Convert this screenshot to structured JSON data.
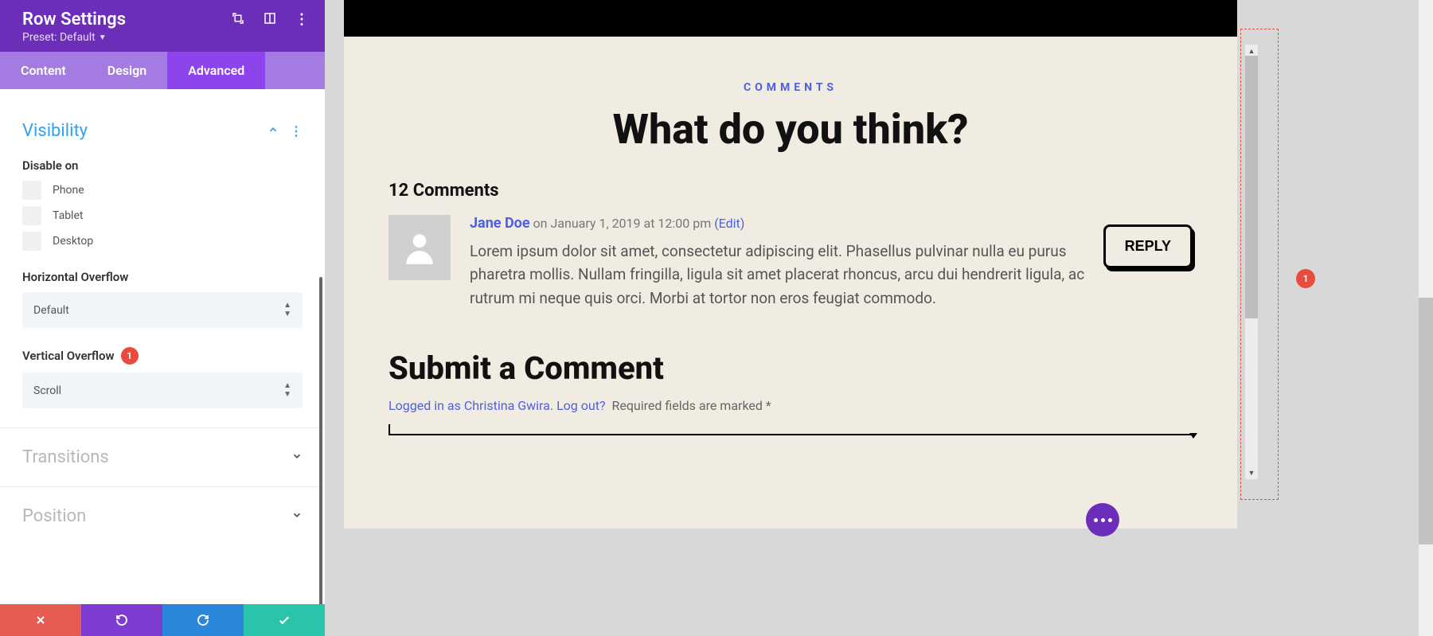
{
  "panel": {
    "title": "Row Settings",
    "preset_label": "Preset: Default",
    "tabs": {
      "content": "Content",
      "design": "Design",
      "advanced": "Advanced"
    }
  },
  "visibility": {
    "title": "Visibility",
    "disable_on": "Disable on",
    "options": {
      "phone": "Phone",
      "tablet": "Tablet",
      "desktop": "Desktop"
    },
    "horizontal_overflow_label": "Horizontal Overflow",
    "horizontal_overflow_value": "Default",
    "vertical_overflow_label": "Vertical Overflow",
    "vertical_overflow_value": "Scroll",
    "vertical_overflow_badge": "1"
  },
  "sections": {
    "transitions": "Transitions",
    "position": "Position"
  },
  "preview": {
    "eyebrow": "COMMENTS",
    "title": "What do you think?",
    "count": "12 Comments",
    "author": "Jane Doe",
    "meta_on": "on January 1, 2019 at 12:00 pm",
    "edit": "(Edit)",
    "body": "Lorem ipsum dolor sit amet, consectetur adipiscing elit. Phasellus pulvinar nulla eu purus pharetra mollis. Nullam fringilla, ligula sit amet placerat rhoncus, arcu dui hendrerit ligula, ac rutrum mi neque quis orci. Morbi at tortor non eros feugiat commodo.",
    "reply": "REPLY",
    "submit_title": "Submit a Comment",
    "logged_in_as": "Logged in as Christina Gwira",
    "logout": "Log out?",
    "required": "Required fields are marked *"
  },
  "annotations": {
    "right_badge": "1"
  }
}
